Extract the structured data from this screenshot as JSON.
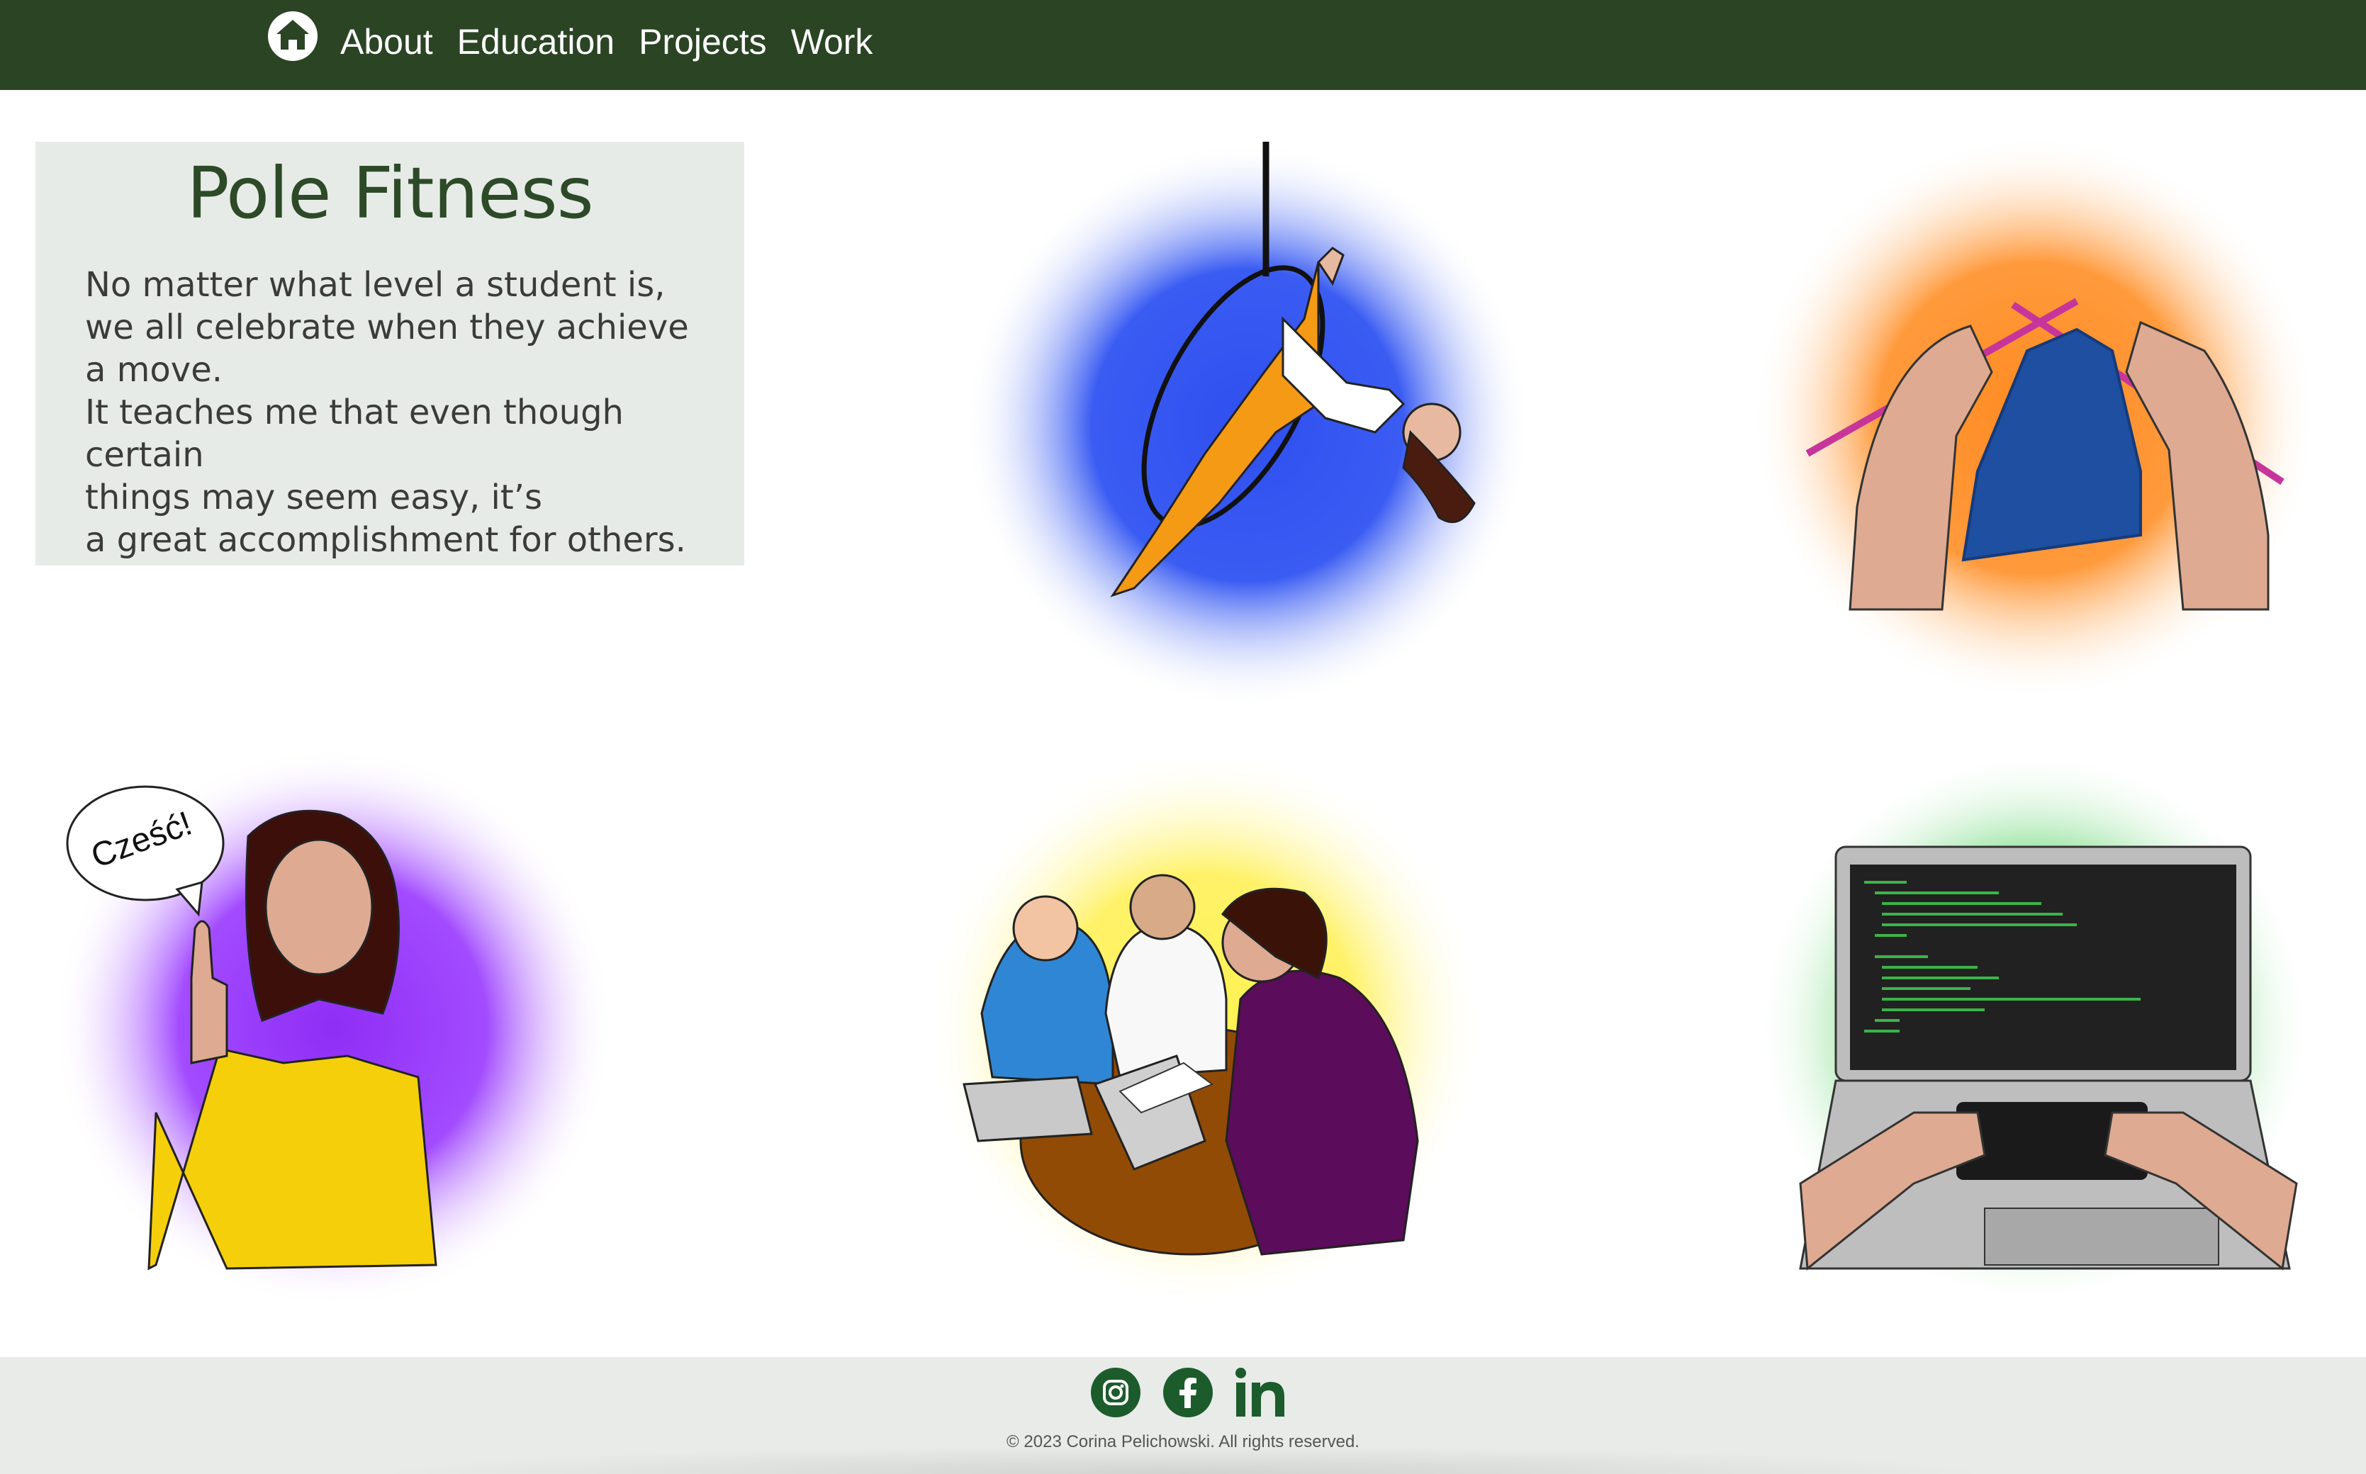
{
  "nav": {
    "home_icon": "home-icon",
    "links": [
      "About",
      "Education",
      "Projects",
      "Work"
    ]
  },
  "card": {
    "title": "Pole Fitness",
    "paragraph1": "No matter what level a student is, we all celebrate when they achieve a move.",
    "paragraph2_line1": "It teaches me that even though certain",
    "paragraph2_line2": "things may seem easy, it’s",
    "paragraph2_line3": "a great accomplishment for others."
  },
  "illustrations": {
    "aerial": {
      "name": "aerial-hoop-illustration",
      "glow": "#3b5bf0"
    },
    "knitting": {
      "name": "knitting-illustration",
      "glow": "#ff9a3c"
    },
    "greeting": {
      "name": "greeting-woman-illustration",
      "glow": "#a24bff",
      "speech": "Cześć!"
    },
    "teamwork": {
      "name": "teamwork-illustration",
      "glow": "#fff26a"
    },
    "coding": {
      "name": "coding-laptop-illustration",
      "glow": "#5fd36b"
    }
  },
  "colors": {
    "nav_bg": "#2a4424",
    "card_bg": "#e7ebe7",
    "footer_bg": "#e8ebe8",
    "title": "#2d4a28"
  },
  "footer": {
    "icons": [
      "instagram-icon",
      "facebook-icon",
      "linkedin-icon"
    ],
    "copyright": "© 2023 Corina Pelichowski. All rights reserved."
  }
}
